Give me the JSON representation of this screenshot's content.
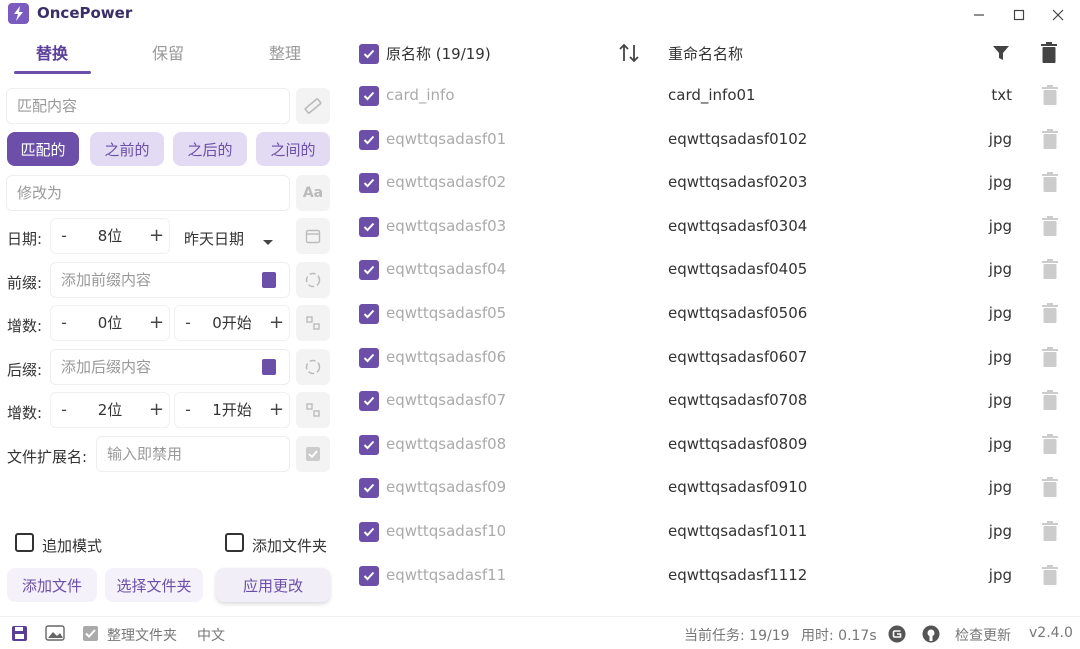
{
  "app": {
    "title": "OncePower"
  },
  "tabs": [
    {
      "label": "替换",
      "active": true
    },
    {
      "label": "保留",
      "active": false
    },
    {
      "label": "整理",
      "active": false
    }
  ],
  "replace": {
    "match_placeholder": "匹配内容",
    "modes": [
      "匹配的",
      "之前的",
      "之后的",
      "之间的"
    ],
    "replace_placeholder": "修改为",
    "date_label": "日期:",
    "date_digits": "8位",
    "date_option": "昨天日期",
    "prefix_label": "前缀:",
    "prefix_placeholder": "添加前缀内容",
    "inc1_label": "增数:",
    "inc1_digits": "0位",
    "inc1_start": "0开始",
    "suffix_label": "后缀:",
    "suffix_placeholder": "添加后缀内容",
    "inc2_label": "增数:",
    "inc2_digits": "2位",
    "inc2_start": "1开始",
    "ext_label": "文件扩展名:",
    "ext_placeholder": "输入即禁用",
    "append_mode": "追加模式",
    "add_folder": "添加文件夹",
    "add_files_btn": "添加文件",
    "choose_folder_btn": "选择文件夹",
    "apply_btn": "应用更改",
    "minus": "-",
    "plus": "+"
  },
  "list": {
    "header_original": "原名称 (19/19)",
    "header_new": "重命名名称",
    "rows": [
      {
        "orig": "card_info",
        "new": "card_info01",
        "ext": "txt"
      },
      {
        "orig": "eqwttqsadasf01",
        "new": "eqwttqsadasf0102",
        "ext": "jpg"
      },
      {
        "orig": "eqwttqsadasf02",
        "new": "eqwttqsadasf0203",
        "ext": "jpg"
      },
      {
        "orig": "eqwttqsadasf03",
        "new": "eqwttqsadasf0304",
        "ext": "jpg"
      },
      {
        "orig": "eqwttqsadasf04",
        "new": "eqwttqsadasf0405",
        "ext": "jpg"
      },
      {
        "orig": "eqwttqsadasf05",
        "new": "eqwttqsadasf0506",
        "ext": "jpg"
      },
      {
        "orig": "eqwttqsadasf06",
        "new": "eqwttqsadasf0607",
        "ext": "jpg"
      },
      {
        "orig": "eqwttqsadasf07",
        "new": "eqwttqsadasf0708",
        "ext": "jpg"
      },
      {
        "orig": "eqwttqsadasf08",
        "new": "eqwttqsadasf0809",
        "ext": "jpg"
      },
      {
        "orig": "eqwttqsadasf09",
        "new": "eqwttqsadasf0910",
        "ext": "jpg"
      },
      {
        "orig": "eqwttqsadasf10",
        "new": "eqwttqsadasf1011",
        "ext": "jpg"
      },
      {
        "orig": "eqwttqsadasf11",
        "new": "eqwttqsadasf1112",
        "ext": "jpg"
      }
    ]
  },
  "status": {
    "organize_files": "整理文件夹",
    "language": "中文",
    "current_task": "当前任务: 19/19",
    "elapsed": "用时: 0.17s",
    "check_update": "检查更新",
    "version": "v2.4.0"
  },
  "colors": {
    "accent": "#6b4fa8",
    "accent_light": "#e3dbf3"
  }
}
